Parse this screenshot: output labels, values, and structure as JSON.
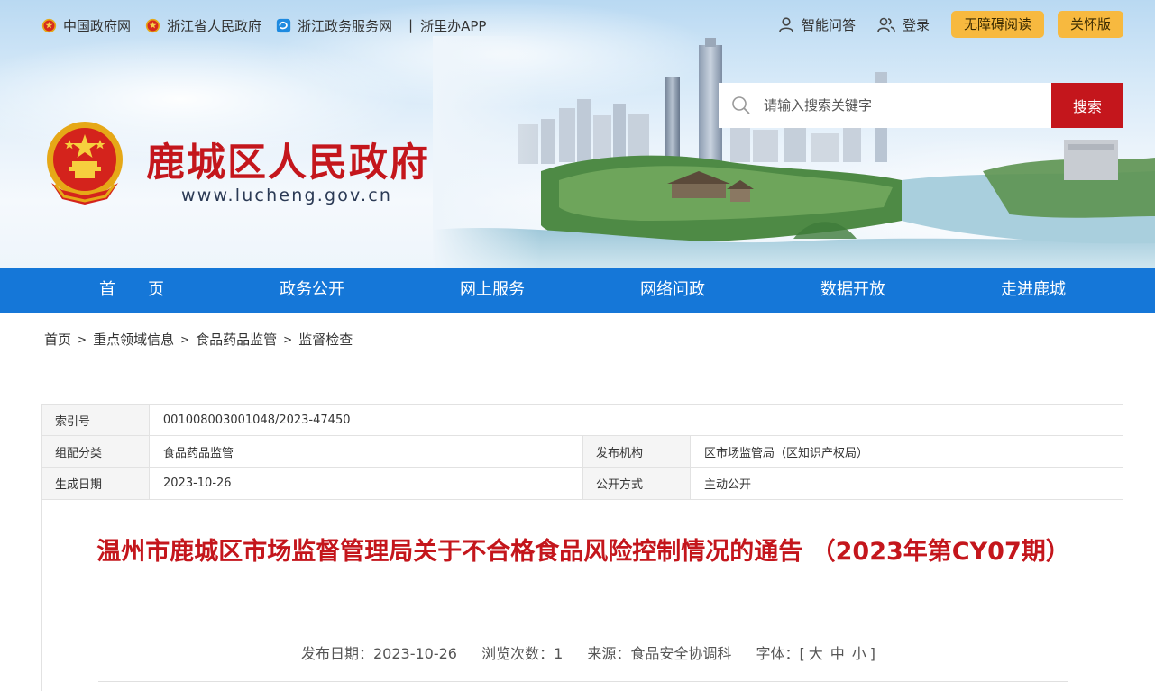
{
  "top_links": [
    {
      "label": "中国政府网",
      "icon": "emblem-icon"
    },
    {
      "label": "浙江省人民政府",
      "icon": "emblem-icon"
    },
    {
      "label": "浙江政务服务网",
      "icon": "zjzw-icon"
    },
    {
      "label": "浙里办APP",
      "icon": ""
    }
  ],
  "top_separator": "|",
  "top_right": {
    "qa_label": "智能问答",
    "login_label": "登录",
    "accessible_label": "无障碍阅读",
    "care_label": "关怀版"
  },
  "site": {
    "title": "鹿城区人民政府",
    "url": "www.lucheng.gov.cn"
  },
  "search": {
    "placeholder": "请输入搜索关键字",
    "button_label": "搜索"
  },
  "nav": [
    "首　　页",
    "政务公开",
    "网上服务",
    "网络问政",
    "数据开放",
    "走进鹿城"
  ],
  "breadcrumb": [
    "首页",
    "重点领域信息",
    "食品药品监管",
    "监督检查"
  ],
  "breadcrumb_separator": ">",
  "info_table": {
    "index_label": "索引号",
    "index_value": "001008003001048/2023-47450",
    "category_label": "组配分类",
    "category_value": "食品药品监管",
    "publisher_label": "发布机构",
    "publisher_value": "区市场监管局（区知识产权局）",
    "date_label": "生成日期",
    "date_value": "2023-10-26",
    "mode_label": "公开方式",
    "mode_value": "主动公开"
  },
  "article": {
    "title": "温州市鹿城区市场监督管理局关于不合格食品风险控制情况的通告 （2023年第CY07期）",
    "publish_date": "发布日期：2023-10-26",
    "views": "浏览次数：1",
    "source": "来源：食品安全协调科",
    "font_label": "字体：[",
    "font_large": "大",
    "font_medium": "中",
    "font_small": "小",
    "font_close": "]"
  },
  "colors": {
    "brand_red": "#c4161c",
    "nav_blue": "#1577d8",
    "pill_yellow": "#f7b93f"
  }
}
